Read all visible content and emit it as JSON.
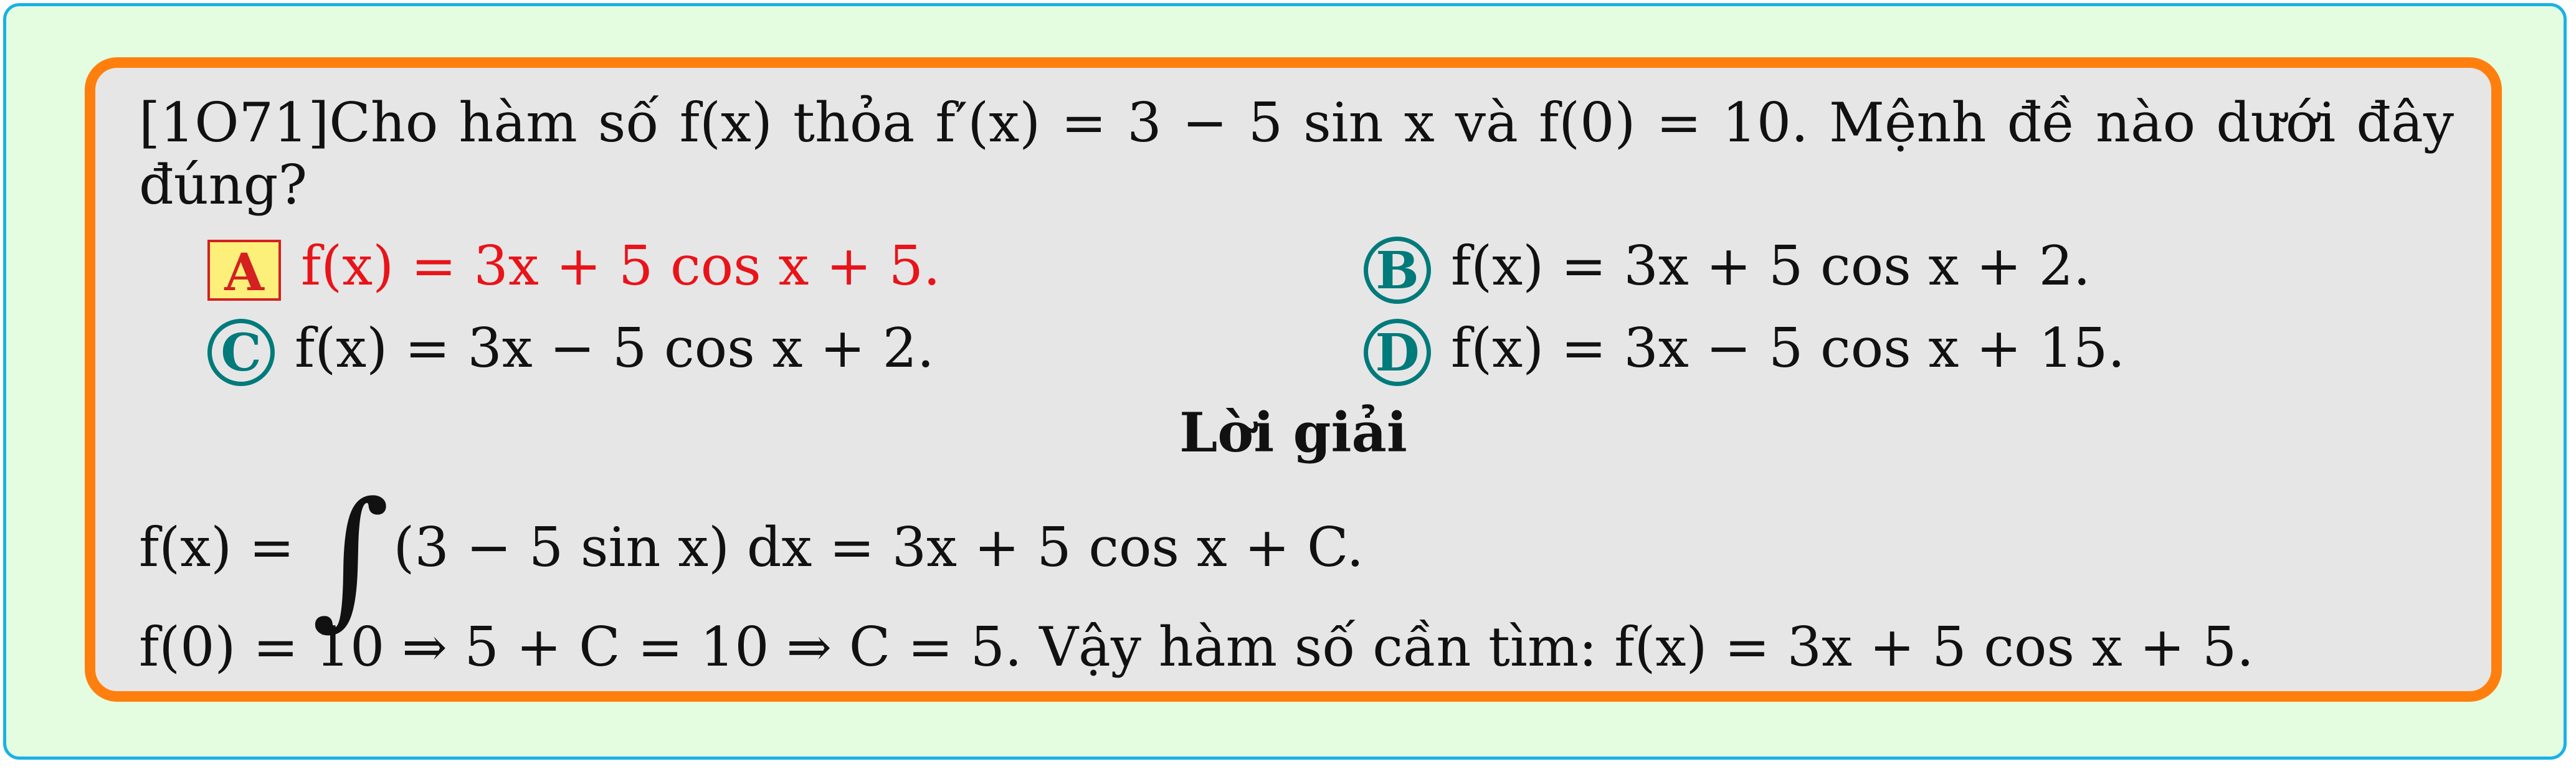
{
  "question": {
    "line1": "[1O71]Cho hàm số f(x) thỏa f′(x) = 3 − 5 sin x và f(0) = 10. Mệnh đề nào dưới đây",
    "line2": "đúng?"
  },
  "options": [
    {
      "label": "A",
      "text": "f(x) = 3x + 5 cos x + 5.",
      "correct": true
    },
    {
      "label": "B",
      "text": "f(x) = 3x + 5 cos x + 2."
    },
    {
      "label": "C",
      "text": "f(x) = 3x − 5 cos x + 2."
    },
    {
      "label": "D",
      "text": "f(x) = 3x − 5 cos x + 15."
    }
  ],
  "solution": {
    "title": "Lời giải",
    "line1_left": "f(x) =",
    "integral_sign": "∫",
    "line1_right": "(3 − 5 sin x) dx = 3x + 5 cos x + C.",
    "line2": "f(0) = 10 ⇒ 5 + C = 10 ⇒ C = 5. Vậy hàm số cần tìm: f(x) = 3x + 5 cos x + 5."
  },
  "colors": {
    "outer_border": "#18b2e6",
    "outer_bg": "#e4fde0",
    "box_border": "#ff7f0e",
    "box_bg": "#e6e6e6",
    "correct_text": "#e8141a",
    "choice_circle": "#007a7a",
    "correct_label_bg": "#fcf07a"
  }
}
